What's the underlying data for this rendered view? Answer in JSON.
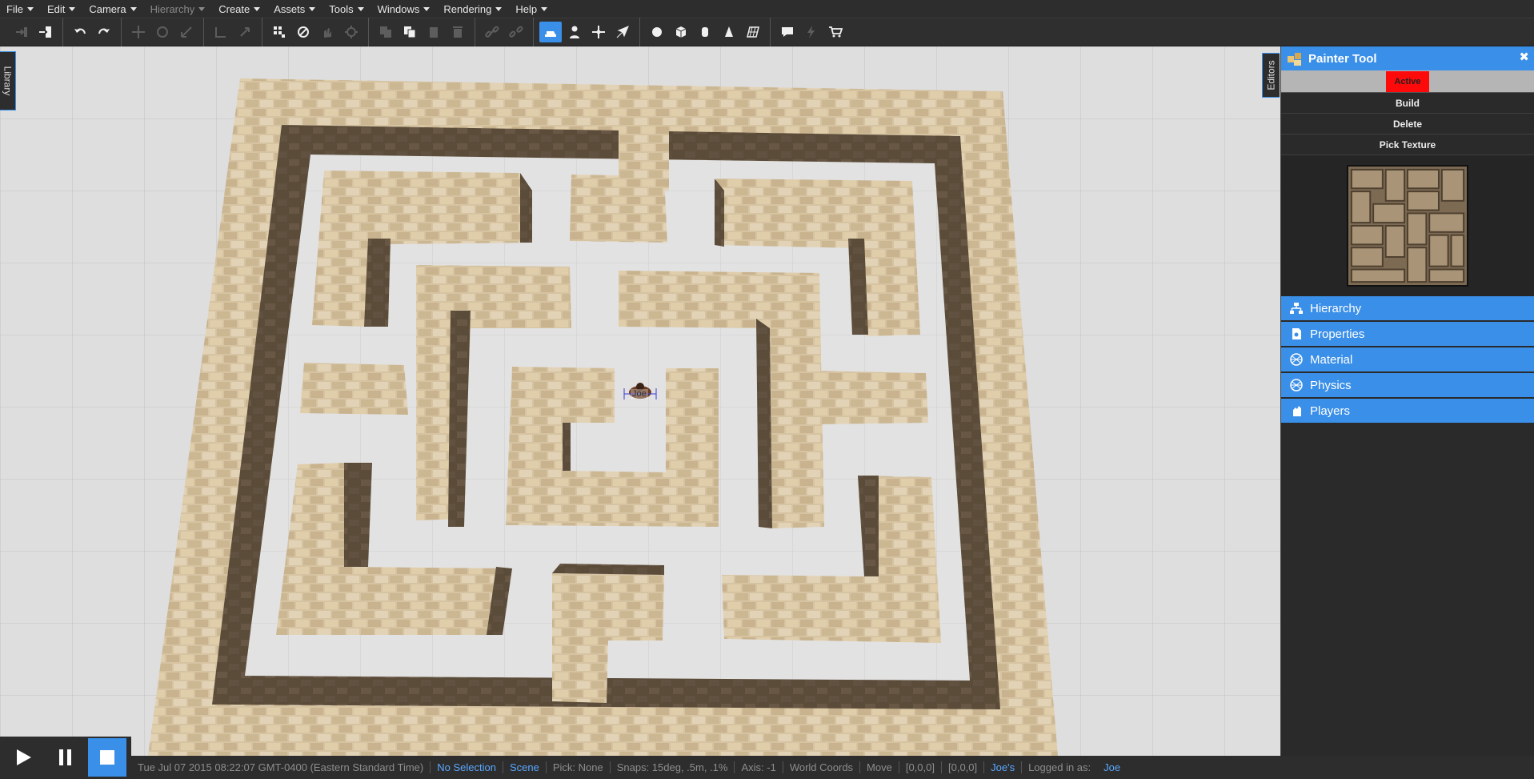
{
  "menu": [
    {
      "label": "File",
      "disabled": false
    },
    {
      "label": "Edit",
      "disabled": false
    },
    {
      "label": "Camera",
      "disabled": false
    },
    {
      "label": "Hierarchy",
      "disabled": true
    },
    {
      "label": "Create",
      "disabled": false
    },
    {
      "label": "Assets",
      "disabled": false
    },
    {
      "label": "Tools",
      "disabled": false
    },
    {
      "label": "Windows",
      "disabled": false
    },
    {
      "label": "Rendering",
      "disabled": false
    },
    {
      "label": "Help",
      "disabled": false
    }
  ],
  "side_tabs": {
    "library": "Library",
    "editors": "Editors"
  },
  "scene": {
    "character_label": "Joe"
  },
  "painter_tool": {
    "title": "Painter Tool",
    "close": "✖",
    "active_label": "Active",
    "active_color": "#ff0a0a",
    "build_label": "Build",
    "delete_label": "Delete",
    "pick_texture_label": "Pick Texture"
  },
  "panels": {
    "hierarchy": "Hierarchy",
    "properties": "Properties",
    "material": "Material",
    "physics": "Physics",
    "players": "Players"
  },
  "status": {
    "datetime": "Tue Jul 07 2015 08:22:07 GMT-0400 (Eastern Standard Time)",
    "selection": "No Selection",
    "scene": "Scene",
    "pick": "Pick: None",
    "snaps": "Snaps: 15deg, .5m, .1%",
    "axis": "Axis: -1",
    "coords": "World Coords",
    "mode": "Move",
    "vec1": "[0,0,0]",
    "vec2": "[0,0,0]",
    "owner": "Joe's",
    "logged_label": "Logged in as:",
    "user": "Joe"
  },
  "colors": {
    "accent": "#3a8fe8",
    "active": "#ff0a0a",
    "background": "#2b2b2b"
  }
}
